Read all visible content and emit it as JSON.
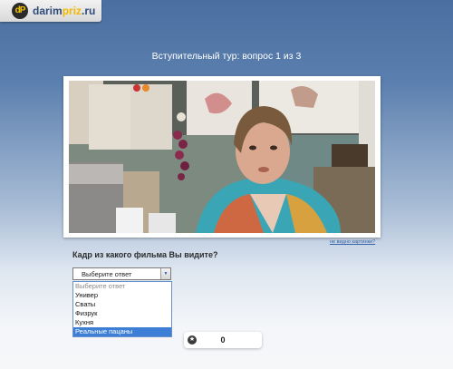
{
  "logo": {
    "icon_text": "dP",
    "name_part1": "darim",
    "name_highlight": "priz",
    "name_part2": ".ru"
  },
  "quiz": {
    "round_title": "Вступительный тур: вопрос 1 из 3",
    "no_image_link": "не видно картинки?",
    "question": "Кадр из какого фильма Вы видите?",
    "select": {
      "value": "Выберите ответ",
      "options": [
        "Выберите ответ",
        "Универ",
        "Сваты",
        "Физрук",
        "Кухня",
        "Реальные пацаны"
      ],
      "highlighted_option": "Реальные пацаны"
    }
  },
  "score": {
    "icon": "star-icon",
    "value": "0"
  },
  "colors": {
    "header_blue": "#4a6fa0",
    "logo_blue": "#2e4b7a",
    "logo_yellow": "#f5b800",
    "highlight": "#3d7fd6"
  }
}
